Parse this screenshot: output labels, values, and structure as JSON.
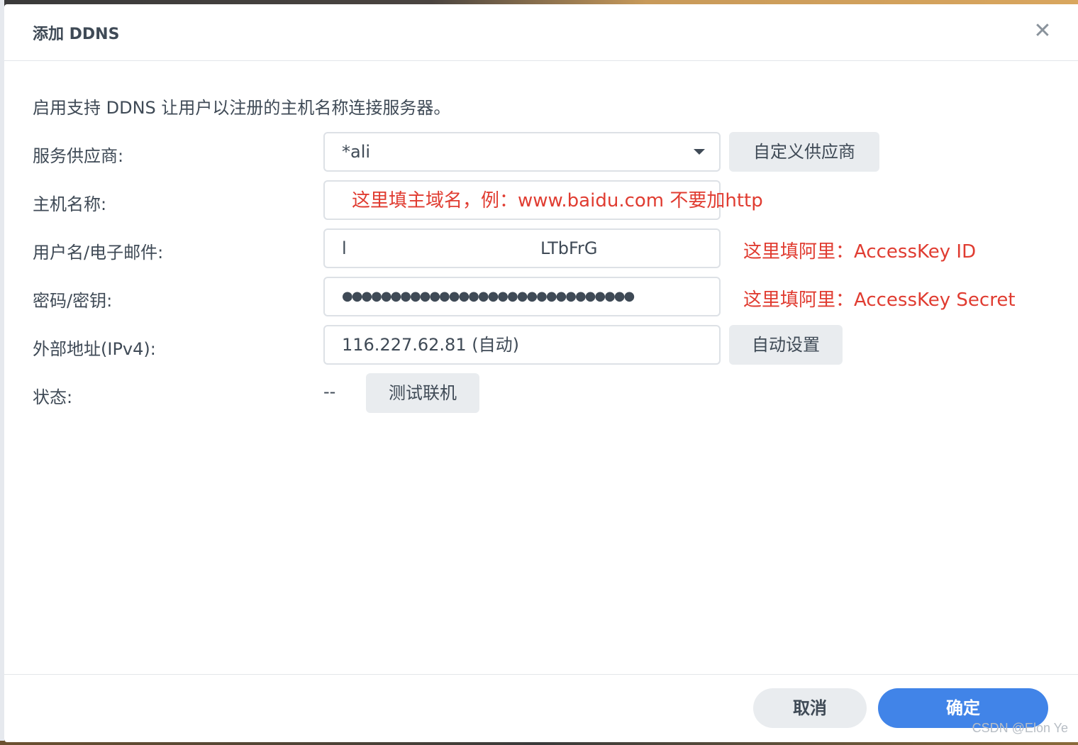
{
  "dialog": {
    "title": "添加 DDNS",
    "close_glyph": "✕",
    "description": "启用支持 DDNS 让用户以注册的主机名称连接服务器。"
  },
  "form": {
    "provider": {
      "label": "服务供应商:",
      "value": "*ali",
      "custom_button": "自定义供应商"
    },
    "hostname": {
      "label": "主机名称:",
      "value": ""
    },
    "username": {
      "label": "用户名/电子邮件:",
      "value_start": "l",
      "value_end": "LTbFrG"
    },
    "password": {
      "label": "密码/密钥:",
      "value": "●●●●●●●●●●●●●●●●●●●●●●●●●●●●●●"
    },
    "external_ip": {
      "label": "外部地址(IPv4):",
      "value": "116.227.62.81 (自动)",
      "auto_button": "自动设置"
    },
    "status": {
      "label": "状态:",
      "value": "--",
      "test_button": "测试联机"
    }
  },
  "annotations": {
    "hostname_note": "这里填主域名，例：www.baidu.com   不要加http",
    "username_note": "这里填阿里：AccessKey ID",
    "password_note": "这里填阿里：AccessKey Secret"
  },
  "footer": {
    "cancel_label": "取消",
    "ok_label": "确定"
  },
  "watermark": "CSDN @Elon Ye",
  "colors": {
    "accent": "#4184e8",
    "annotation": "#e03c31",
    "text": "#3f4a56"
  }
}
